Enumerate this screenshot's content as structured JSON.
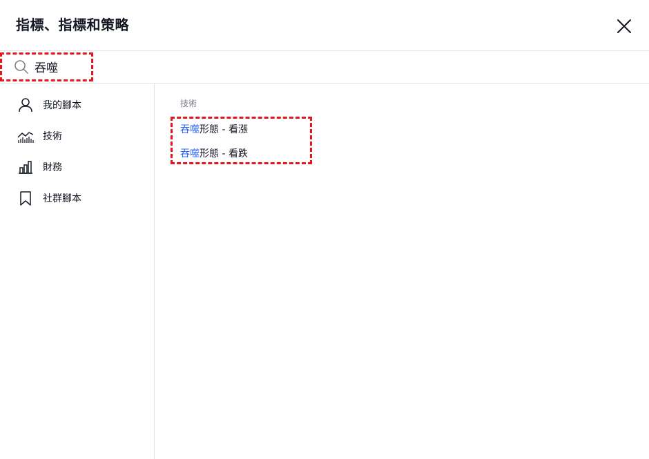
{
  "header": {
    "title": "指標、指標和策略",
    "close_icon": "close-icon"
  },
  "search": {
    "value": "吞噬",
    "placeholder": "",
    "icon": "search-icon"
  },
  "sidebar": {
    "items": [
      {
        "label": "我的腳本",
        "icon": "user-icon"
      },
      {
        "label": "技術",
        "icon": "technical-chart-icon"
      },
      {
        "label": "財務",
        "icon": "bar-chart-icon"
      },
      {
        "label": "社群腳本",
        "icon": "bookmark-icon"
      }
    ]
  },
  "results": {
    "section_label": "技術",
    "items": [
      {
        "match": "吞噬",
        "rest": "形態 - 看漲"
      },
      {
        "match": "吞噬",
        "rest": "形態 - 看跌"
      }
    ]
  },
  "colors": {
    "highlight": "#2962ff",
    "annotation": "#e8141c",
    "divider": "#e0e3eb",
    "muted": "#787b86"
  }
}
